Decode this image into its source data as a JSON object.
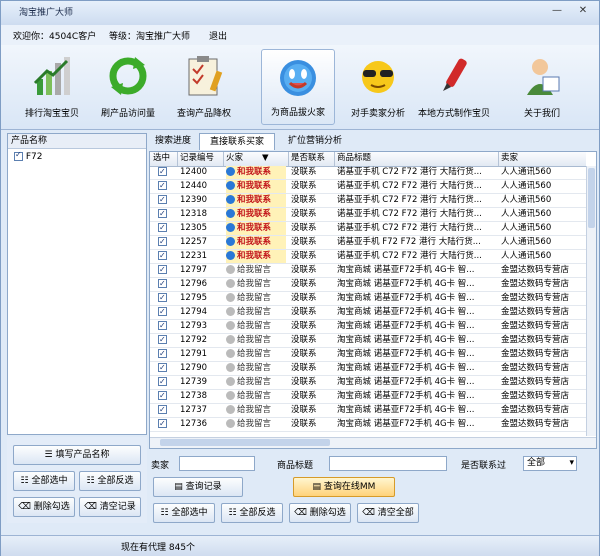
{
  "window": {
    "title": "淘宝推广大师",
    "min": "—",
    "close": "✕"
  },
  "userbar": {
    "welcome": "欢迎你：4504C客户",
    "level": "等级：淘宝推广大师",
    "logout": "退出"
  },
  "toolbar": [
    {
      "label": "排行淘宝宝贝",
      "icon": "bar-chart-icon"
    },
    {
      "label": "刷产品访问量",
      "icon": "recycle-arrows-icon"
    },
    {
      "label": "查询产品降权",
      "icon": "clipboard-check-icon"
    },
    {
      "label": "为商品拔火家",
      "icon": "smiley-ball-icon",
      "active": true
    },
    {
      "label": "对手卖家分析",
      "icon": "sunglasses-face-icon"
    },
    {
      "label": "本地方式制作宝贝",
      "icon": "pen-icon"
    },
    {
      "label": "关于我们",
      "icon": "person-book-icon"
    }
  ],
  "left": {
    "header": "产品名称",
    "items": [
      {
        "label": "F72",
        "checked": true
      }
    ],
    "buttons": {
      "edit": "填写产品名称",
      "select_all": "全部选中",
      "invert": "全部反选",
      "delete": "删除勾选",
      "clear": "清空记录"
    }
  },
  "tabs": [
    "搜索进度",
    "直接联系买家",
    "扩位营销分析"
  ],
  "grid": {
    "columns": [
      "选中",
      "记录编号",
      "火家",
      "是否联系",
      "商品标题",
      "卖家"
    ],
    "rows": [
      {
        "checked": true,
        "id": "12400",
        "tag": "和我联系",
        "hot": true,
        "contact": "没联系",
        "title": "诺基亚手机 C72 F72 港行 大陆行货...",
        "seller": "人人通讯560"
      },
      {
        "checked": true,
        "id": "12440",
        "tag": "和我联系",
        "hot": true,
        "contact": "没联系",
        "title": "诺基亚手机 C72 F72 港行 大陆行货...",
        "seller": "人人通讯560"
      },
      {
        "checked": true,
        "id": "12390",
        "tag": "和我联系",
        "hot": true,
        "contact": "没联系",
        "title": "诺基亚手机 C72 F72 港行 大陆行货...",
        "seller": "人人通讯560"
      },
      {
        "checked": true,
        "id": "12318",
        "tag": "和我联系",
        "hot": true,
        "contact": "没联系",
        "title": "诺基亚手机 C72 F72 港行 大陆行货...",
        "seller": "人人通讯560"
      },
      {
        "checked": true,
        "id": "12305",
        "tag": "和我联系",
        "hot": true,
        "contact": "没联系",
        "title": "诺基亚手机 C72 F72 港行 大陆行货...",
        "seller": "人人通讯560"
      },
      {
        "checked": true,
        "id": "12257",
        "tag": "和我联系",
        "hot": true,
        "contact": "没联系",
        "title": "诺基亚手机 F72 F72 港行 大陆行货...",
        "seller": "人人通讯560"
      },
      {
        "checked": true,
        "id": "12231",
        "tag": "和我联系",
        "hot": true,
        "contact": "没联系",
        "title": "诺基亚手机 C72 F72 港行 大陆行货...",
        "seller": "人人通讯560"
      },
      {
        "checked": true,
        "id": "12797",
        "tag": "给我留言",
        "hot": false,
        "contact": "没联系",
        "title": "淘宝商城 诺基亚F72手机 4G卡 智...",
        "seller": "金盟达数码专营店"
      },
      {
        "checked": true,
        "id": "12796",
        "tag": "给我留言",
        "hot": false,
        "contact": "没联系",
        "title": "淘宝商城 诺基亚F72手机 4G卡 智...",
        "seller": "金盟达数码专营店"
      },
      {
        "checked": true,
        "id": "12795",
        "tag": "给我留言",
        "hot": false,
        "contact": "没联系",
        "title": "淘宝商城 诺基亚F72手机 4G卡 智...",
        "seller": "金盟达数码专营店"
      },
      {
        "checked": true,
        "id": "12794",
        "tag": "给我留言",
        "hot": false,
        "contact": "没联系",
        "title": "淘宝商城 诺基亚F72手机 4G卡 智...",
        "seller": "金盟达数码专营店"
      },
      {
        "checked": true,
        "id": "12793",
        "tag": "给我留言",
        "hot": false,
        "contact": "没联系",
        "title": "淘宝商城 诺基亚F72手机 4G卡 智...",
        "seller": "金盟达数码专营店"
      },
      {
        "checked": true,
        "id": "12792",
        "tag": "给我留言",
        "hot": false,
        "contact": "没联系",
        "title": "淘宝商城 诺基亚F72手机 4G卡 智...",
        "seller": "金盟达数码专营店"
      },
      {
        "checked": true,
        "id": "12791",
        "tag": "给我留言",
        "hot": false,
        "contact": "没联系",
        "title": "淘宝商城 诺基亚F72手机 4G卡 智...",
        "seller": "金盟达数码专营店"
      },
      {
        "checked": true,
        "id": "12790",
        "tag": "给我留言",
        "hot": false,
        "contact": "没联系",
        "title": "淘宝商城 诺基亚F72手机 4G卡 智...",
        "seller": "金盟达数码专营店"
      },
      {
        "checked": true,
        "id": "12739",
        "tag": "给我留言",
        "hot": false,
        "contact": "没联系",
        "title": "淘宝商城 诺基亚F72手机 4G卡 智...",
        "seller": "金盟达数码专营店"
      },
      {
        "checked": true,
        "id": "12738",
        "tag": "给我留言",
        "hot": false,
        "contact": "没联系",
        "title": "淘宝商城 诺基亚F72手机 4G卡 智...",
        "seller": "金盟达数码专营店"
      },
      {
        "checked": true,
        "id": "12737",
        "tag": "给我留言",
        "hot": false,
        "contact": "没联系",
        "title": "淘宝商城 诺基亚F72手机 4G卡 智...",
        "seller": "金盟达数码专营店"
      },
      {
        "checked": true,
        "id": "12736",
        "tag": "给我留言",
        "hot": false,
        "contact": "没联系",
        "title": "淘宝商城 诺基亚F72手机 4G卡 智...",
        "seller": "金盟达数码专营店"
      }
    ]
  },
  "filters": {
    "seller_label": "卖家",
    "seller_value": "",
    "title_label": "商品标题",
    "title_value": "",
    "contact_label": "是否联系过",
    "contact_value": "全部",
    "query": "查询记录",
    "query_online": "查询在线MM",
    "select_all": "全部选中",
    "invert": "全部反选",
    "delete": "删除勾选",
    "clear": "清空全部"
  },
  "status": {
    "text": "现在有代理 845个"
  },
  "colors": {
    "accent": "#3b6ab5",
    "hot": "#c2161b"
  }
}
